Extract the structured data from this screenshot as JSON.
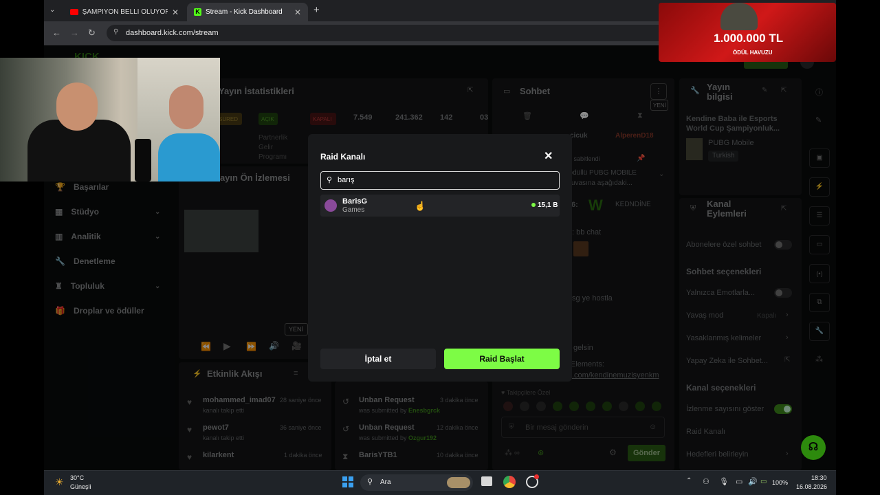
{
  "browser": {
    "tabs": [
      {
        "label": "ŞAMPİYON BELLİ OLUYOR! I 20",
        "icon": "youtube-icon"
      },
      {
        "label": "Stream - Kick Dashboard",
        "icon": "kick-icon"
      }
    ],
    "url": "dashboard.kick.com/stream"
  },
  "promo": {
    "amount": "1.000.000 TL",
    "sub": "ÖDÜL HAVUZU"
  },
  "sidebar": {
    "items": [
      {
        "label": "Başarılar"
      },
      {
        "label": "Stüdyo"
      },
      {
        "label": "Analitik"
      },
      {
        "label": "Denetleme"
      },
      {
        "label": "Topluluk"
      },
      {
        "label": "Droplar ve ödüller"
      }
    ]
  },
  "stats": {
    "title": "Yayın İstatistikleri",
    "badges": [
      "SURED",
      "AÇIK",
      "KAPALI"
    ],
    "partner": "Partnerlik Gelir Programı",
    "numbers": [
      "7.549",
      "241.362",
      "142",
      "03"
    ]
  },
  "preview": {
    "title": "Yayın Ön İzlemesi",
    "new": "YENİ"
  },
  "activity": {
    "title": "Etkinlik Akışı",
    "items": [
      {
        "name": "mohammed_imad07",
        "time": "28 saniye önce",
        "desc": "kanalı takip etti"
      },
      {
        "name": "pewot7",
        "time": "36 saniye önce",
        "desc": "kanalı takip etti"
      },
      {
        "name": "kilarkent",
        "time": "1 dakika önce",
        "desc": ""
      }
    ]
  },
  "requests": {
    "items": [
      {
        "title": "Unban Request",
        "time": "3 dakika önce",
        "by": "was submitted by",
        "user": "Enesbgrck"
      },
      {
        "title": "Unban Request",
        "time": "12 dakika önce",
        "by": "was submitted by",
        "user": "Ozgur192"
      },
      {
        "title": "BarisYTB1",
        "time": "10 dakika önce",
        "by": "",
        "user": ""
      }
    ]
  },
  "chat": {
    "title": "Sohbet",
    "new": "YENİ",
    "users": [
      "cicuk",
      "AlperenD18"
    ],
    "pinned": "an sabitlendi",
    "pinned_text": ". ödüllü PUBG MOBILE rnuvasına aşağıdaki...",
    "lines": [
      "6:",
      "KEDNDİNE",
      ": bb chat",
      "sg ye hostla",
      "gelsin",
      "Elements:",
      ".com/kendinemuzisyenkm"
    ],
    "followers_only": "Takipçilere Özel",
    "placeholder": "Bir mesaj gönderin",
    "send": "Gönder"
  },
  "stream_info": {
    "title": "Yayın bilgisi",
    "name": "Kendine Baba ile Esports World Cup Şampiyonluk...",
    "category": "PUBG Mobile",
    "lang": "Turkish"
  },
  "channel_actions": {
    "title": "Kanal Eylemleri",
    "sub_only": "Abonelere özel sohbet",
    "chat_options": "Sohbet seçenekleri",
    "emotes_only": "Yalnızca Emotlarla...",
    "slow_mode": "Yavaş mod",
    "slow_mode_value": "Kapalı",
    "banned_words": "Yasaklanmış kelimeler",
    "ai_chat": "Yapay Zeka ile Sohbet...",
    "channel_options": "Kanal seçenekleri",
    "show_views": "İzlenme sayısını göster",
    "raid": "Raid Kanalı",
    "goals": "Hedefleri belirleyin"
  },
  "modal": {
    "title": "Raid Kanalı",
    "search_value": "barış",
    "result": {
      "name": "BarisG",
      "category": "Games",
      "viewers": "15,1 B"
    },
    "cancel": "İptal et",
    "confirm": "Raid Başlat"
  },
  "taskbar": {
    "weather_temp": "30°C",
    "weather_desc": "Güneşli",
    "search": "Ara",
    "battery": "100%",
    "time": "18:30",
    "date": "16.08.2026"
  },
  "colors": {
    "accent": "#7dfc45",
    "bg": "#0a0b0c",
    "panel": "#141517"
  }
}
